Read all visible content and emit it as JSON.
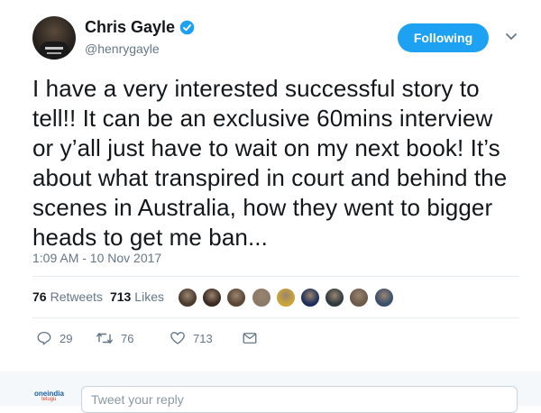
{
  "user": {
    "name": "Chris Gayle",
    "handle": "@henrygayle",
    "verified": true
  },
  "follow_button": {
    "label": "Following"
  },
  "tweet": {
    "text": "I have a very interested successful story to tell!! It can be an exclusive 60mins interview or y’all just have to wait on my next book! It’s about what transpired in court and behind the scenes in Australia, how they went to bigger heads to get me ban...",
    "timestamp": "1:09 AM - 10 Nov 2017"
  },
  "stats": {
    "retweets_count": "76",
    "retweets_label": "Retweets",
    "likes_count": "713",
    "likes_label": "Likes"
  },
  "likers": [
    {
      "color": "#4a3a2e"
    },
    {
      "color": "#3b2a22"
    },
    {
      "color": "#5b4636"
    },
    {
      "color": "#8a7a66"
    },
    {
      "color": "#c9a43a"
    },
    {
      "color": "#1f2f5a"
    },
    {
      "color": "#2e3a3e"
    },
    {
      "color": "#6b5a4a"
    },
    {
      "color": "#3a4f6b"
    }
  ],
  "actions": {
    "reply_count": "29",
    "retweet_count": "76",
    "like_count": "713"
  },
  "reply": {
    "placeholder": "Tweet your reply"
  },
  "brand": {
    "line1": "oneindia",
    "line2": "telugu"
  },
  "colors": {
    "accent": "#1da1f2",
    "muted": "#657786",
    "text": "#14171a"
  }
}
